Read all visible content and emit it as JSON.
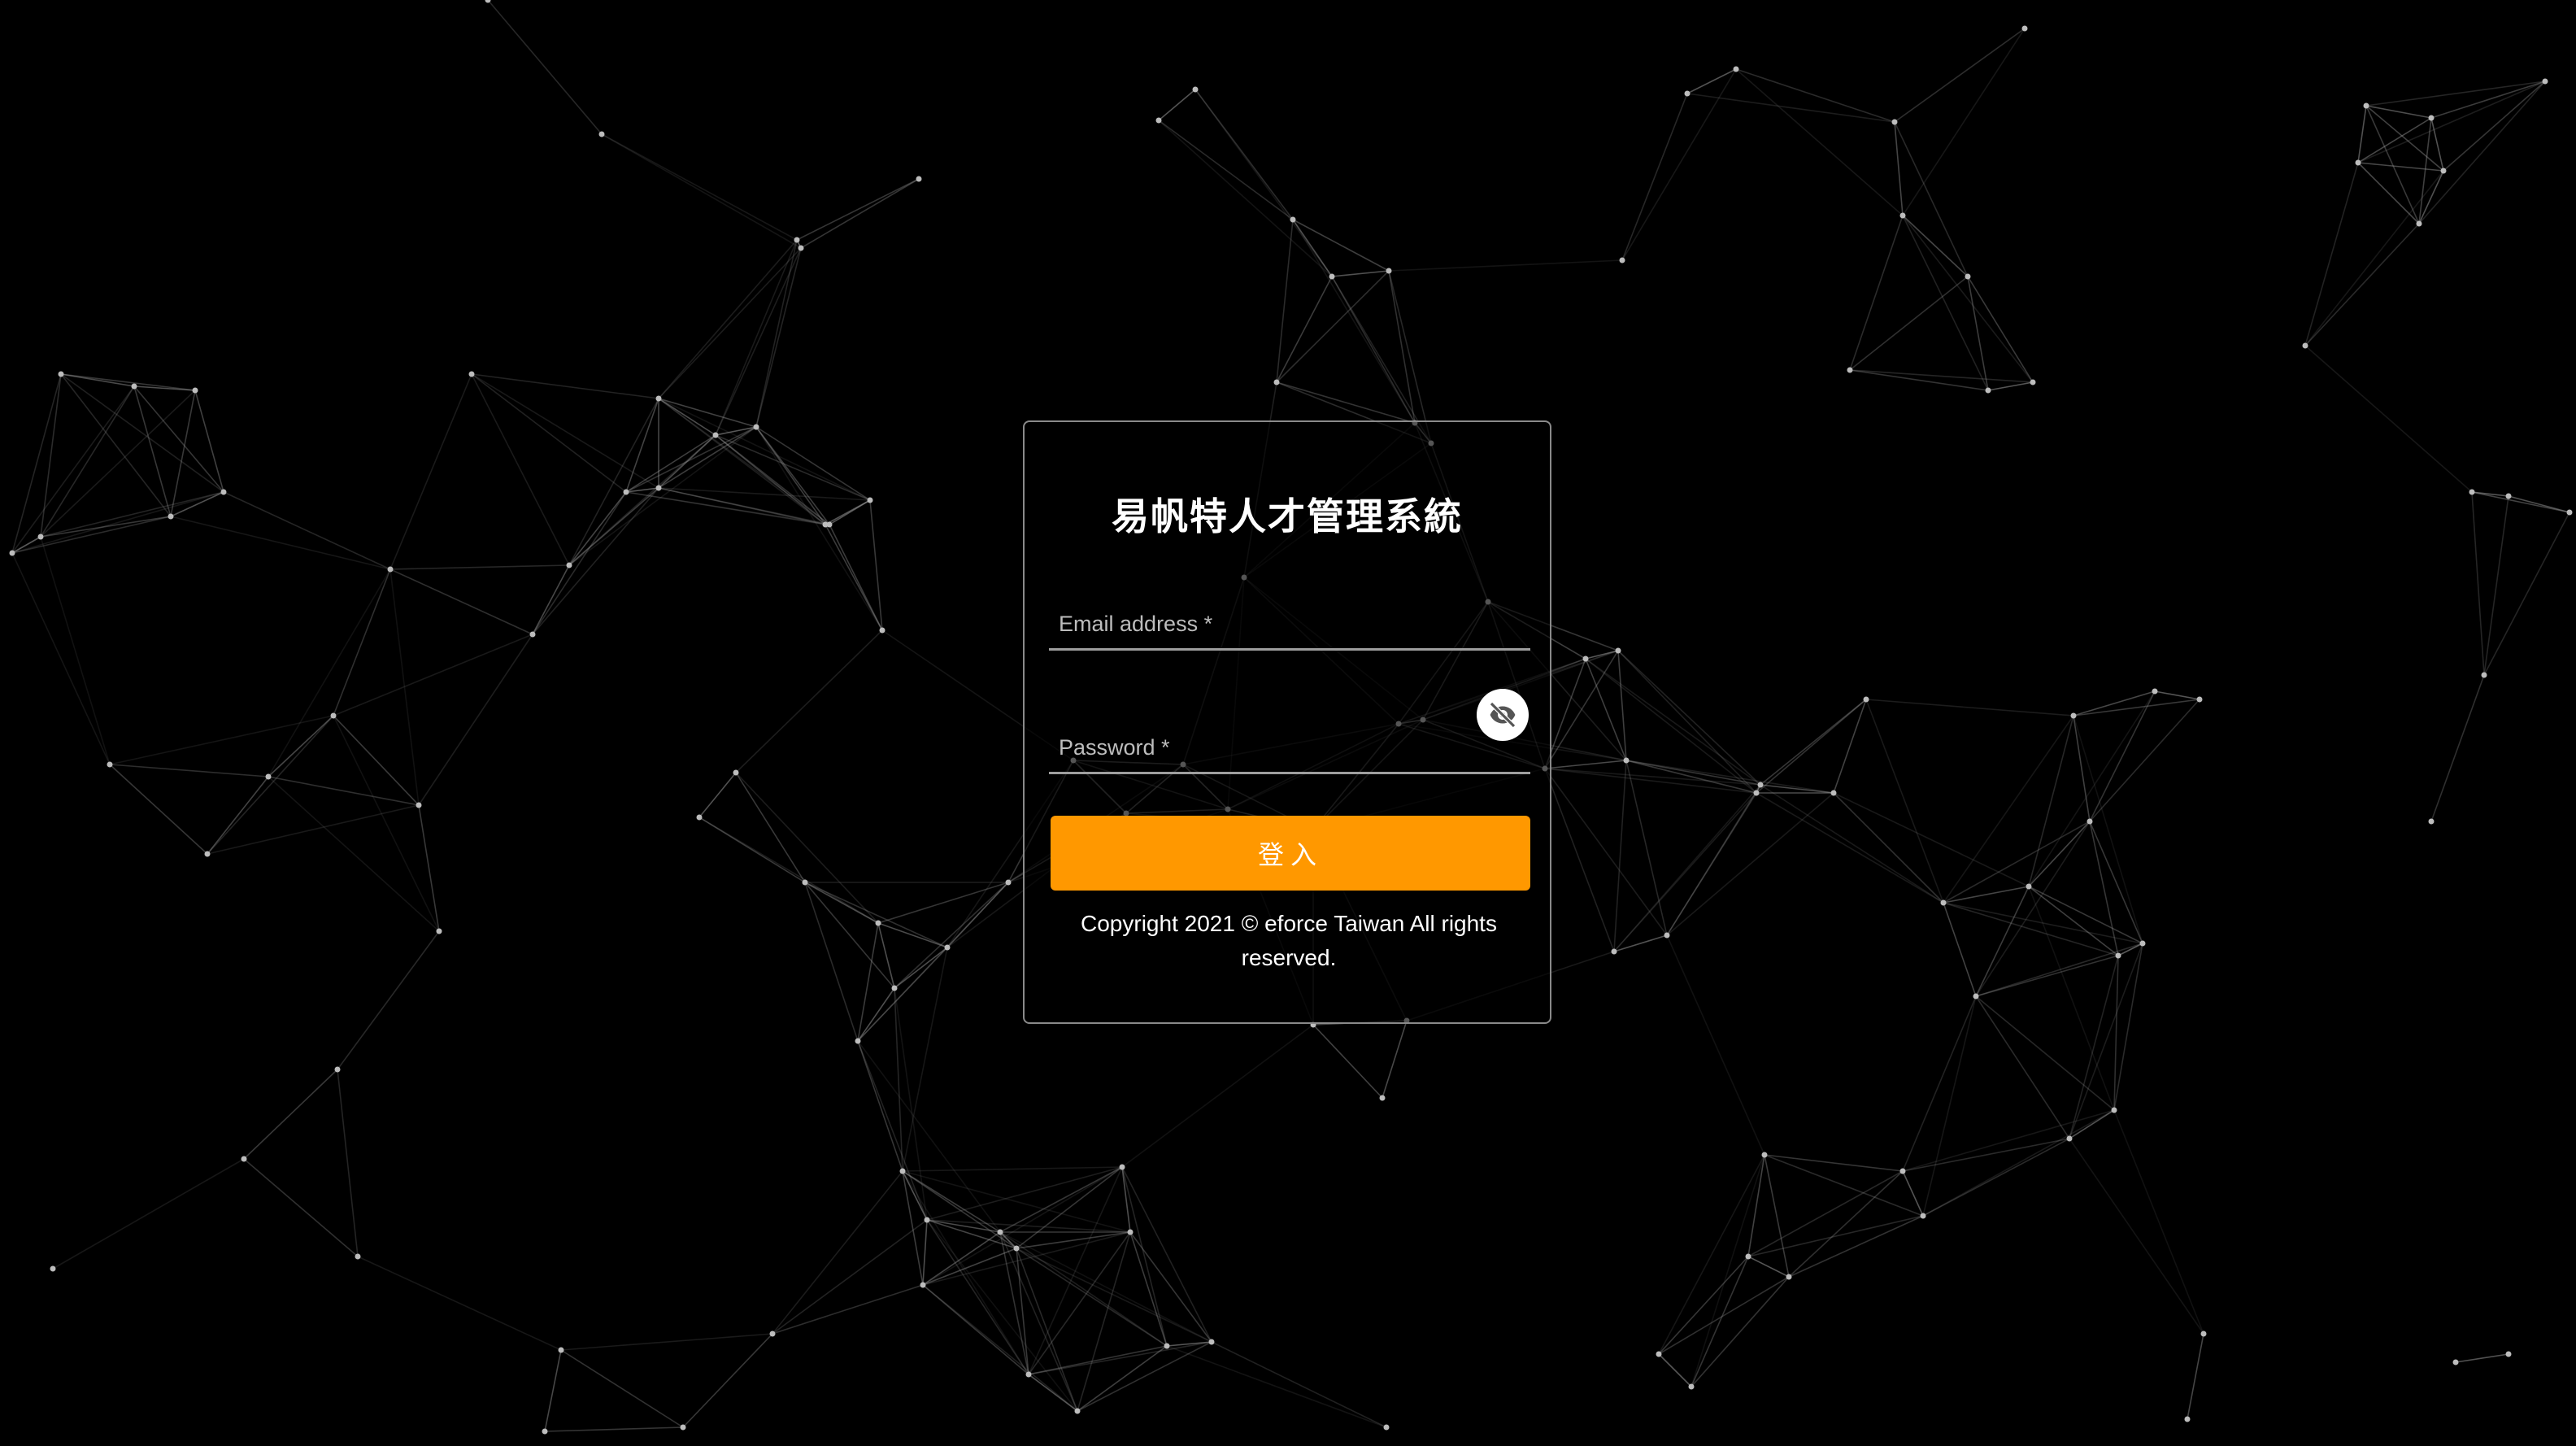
{
  "app": {
    "title": "易帆特人才管理系統"
  },
  "form": {
    "email_label": "Email address *",
    "email_value": "",
    "password_label": "Password *",
    "password_value": "",
    "toggle_password_icon": "eye-off-icon",
    "submit_label": "登入"
  },
  "footer": {
    "copyright": "Copyright 2021 © eforce Taiwan All rights reserved."
  },
  "colors": {
    "background": "#000000",
    "accent": "#ff9800",
    "card_border": "#8a8a8a",
    "text": "#ffffff"
  }
}
